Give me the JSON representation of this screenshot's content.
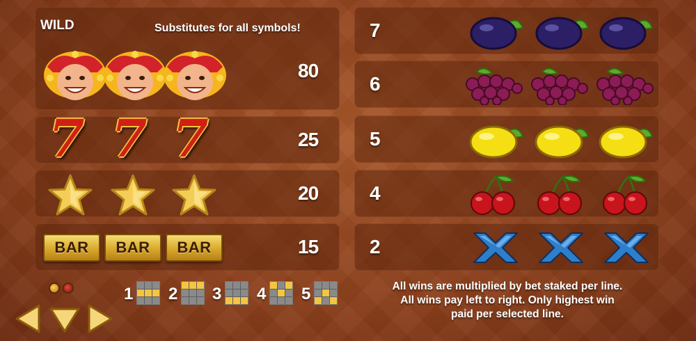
{
  "wild": {
    "title": "WILD",
    "description": "Substitutes for all symbols!",
    "payout": "80"
  },
  "left_rows": [
    {
      "symbol": "seven",
      "glyph": "7",
      "payout": "25"
    },
    {
      "symbol": "star",
      "payout": "20"
    },
    {
      "symbol": "bar",
      "glyph": "BAR",
      "payout": "15"
    }
  ],
  "right_rows": [
    {
      "label": "7",
      "symbol": "plum"
    },
    {
      "label": "6",
      "symbol": "grapes"
    },
    {
      "label": "5",
      "symbol": "lemon"
    },
    {
      "label": "4",
      "symbol": "cherry"
    },
    {
      "label": "2",
      "symbol": "x-symbol"
    }
  ],
  "lines": [
    {
      "number": "1",
      "pattern": [
        0,
        0,
        0,
        1,
        1,
        1,
        0,
        0,
        0
      ]
    },
    {
      "number": "2",
      "pattern": [
        1,
        1,
        1,
        0,
        0,
        0,
        0,
        0,
        0
      ]
    },
    {
      "number": "3",
      "pattern": [
        0,
        0,
        0,
        0,
        0,
        0,
        1,
        1,
        1
      ]
    },
    {
      "number": "4",
      "pattern": [
        1,
        0,
        1,
        0,
        1,
        0,
        0,
        0,
        0
      ]
    },
    {
      "number": "5",
      "pattern": [
        0,
        0,
        0,
        0,
        1,
        0,
        1,
        0,
        1
      ]
    }
  ],
  "info_text": {
    "line1": "All wins are multiplied by bet staked per line.",
    "line2": "All wins pay left to right. Only highest win",
    "line3": "paid per selected line."
  },
  "page_indicator": {
    "total": 2,
    "current": 1
  },
  "colors": {
    "accent_gold": "#f5c842",
    "panel": "#5f260c",
    "red": "#d21f16"
  }
}
